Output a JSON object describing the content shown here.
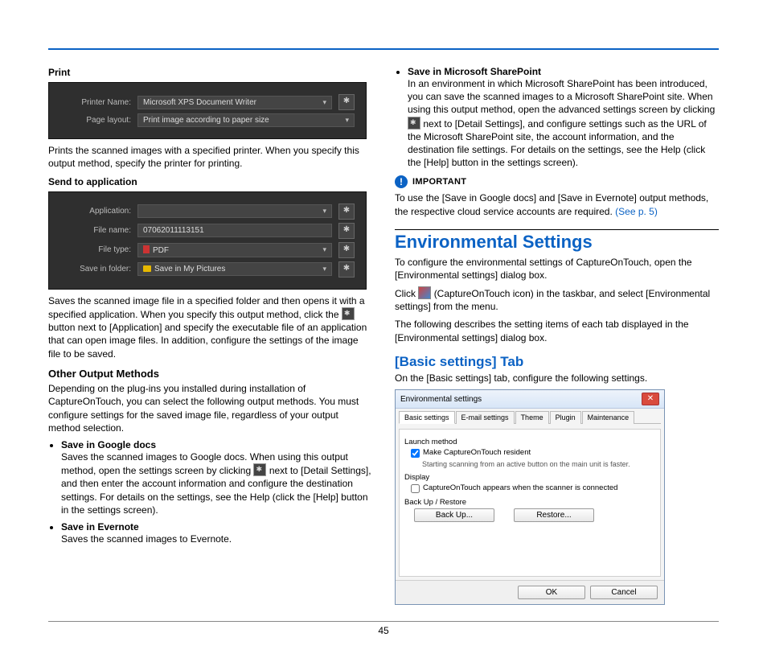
{
  "left": {
    "print_h": "Print",
    "print_panel": {
      "row1_label": "Printer Name:",
      "row1_value": "Microsoft XPS Document Writer",
      "row2_label": "Page layout:",
      "row2_value": "Print image according to paper size"
    },
    "print_body": "Prints the scanned images with a specified printer. When you specify this output method, specify the printer for printing.",
    "send_h": "Send to application",
    "send_panel": {
      "r1l": "Application:",
      "r2l": "File name:",
      "r2v": "07062011113151",
      "r3l": "File type:",
      "r3v": "PDF",
      "r4l": "Save in folder:",
      "r4v": "Save in My Pictures"
    },
    "send_body_a": "Saves the scanned image file in a specified folder and then opens it with a specified application. When you specify this output method, click the ",
    "send_body_b": " button next to [Application] and specify the executable file of an application that can open image files. In addition, configure the settings of the image file to be saved.",
    "other_h": "Other Output Methods",
    "other_body": "Depending on the plug-ins you installed during installation of CaptureOnTouch, you can select the following output methods. You must configure settings for the saved image file, regardless of your output method selection.",
    "b1_t": "Save in Google docs",
    "b1_a": "Saves the scanned images to Google docs. When using this output method, open the settings screen by clicking ",
    "b1_b": " next to [Detail Settings], and then enter the account information and configure the destination settings. For details on the settings, see the Help (click the [Help] button in the settings screen).",
    "b2_t": "Save in Evernote",
    "b2_a": "Saves the scanned images to Evernote."
  },
  "right": {
    "sp_t": "Save in Microsoft SharePoint",
    "sp_a": "In an environment in which Microsoft SharePoint has been introduced, you can save the scanned images to a Microsoft SharePoint site. When using this output method, open the advanced settings screen by clicking ",
    "sp_b": " next to [Detail Settings], and configure settings such as the URL of the Microsoft SharePoint site, the account information, and the destination file settings. For details on the settings, see the Help (click the [Help] button in the settings screen).",
    "imp_label": "IMPORTANT",
    "imp_body_a": "To use the [Save in Google docs] and [Save in Evernote] output methods, the respective cloud service accounts are required. ",
    "imp_link": "(See p. 5)",
    "env_h": "Environmental Settings",
    "env_p1": "To configure the environmental settings of CaptureOnTouch, open the [Environmental settings] dialog box.",
    "env_p2a": "Click ",
    "env_p2b": " (CaptureOnTouch icon) in the taskbar, and select [Environmental settings] from the menu.",
    "env_p3": "The following describes the setting items of each tab displayed in the [Environmental settings] dialog box.",
    "basic_h": "[Basic settings] Tab",
    "basic_p": "On the [Basic settings] tab, configure the following settings.",
    "dlg": {
      "title": "Environmental settings",
      "tabs": [
        "Basic settings",
        "E-mail settings",
        "Theme",
        "Plugin",
        "Maintenance"
      ],
      "g1": "Launch method",
      "g1_cb": "Make CaptureOnTouch resident",
      "g1_hint": "Starting scanning from an active button on the main unit is faster.",
      "g2": "Display",
      "g2_cb": "CaptureOnTouch appears when the scanner is connected",
      "g3": "Back Up / Restore",
      "btn_backup": "Back Up...",
      "btn_restore": "Restore...",
      "ok": "OK",
      "cancel": "Cancel"
    }
  },
  "page_no": "45"
}
